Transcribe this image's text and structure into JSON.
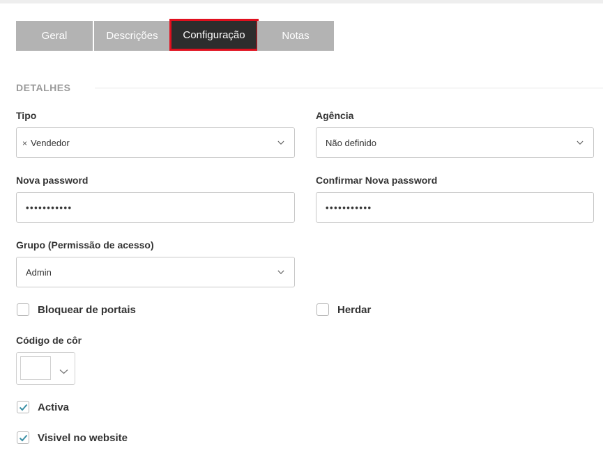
{
  "tabs": [
    {
      "label": "Geral"
    },
    {
      "label": "Descrições"
    },
    {
      "label": "Configuração"
    },
    {
      "label": "Notas"
    }
  ],
  "section": {
    "title": "DETALHES"
  },
  "fields": {
    "tipo": {
      "label": "Tipo",
      "value": "Vendedor",
      "remove": "×"
    },
    "agencia": {
      "label": "Agência",
      "value": "Não definido"
    },
    "nova_password": {
      "label": "Nova password",
      "value": "•••••••••••"
    },
    "confirmar_password": {
      "label": "Confirmar Nova password",
      "value": "•••••••••••"
    },
    "grupo": {
      "label": "Grupo (Permissão de acesso)",
      "value": "Admin"
    },
    "codigo_cor": {
      "label": "Código de côr",
      "value": "#ffffff"
    }
  },
  "checkboxes": {
    "bloquear": {
      "label": "Bloquear de portais",
      "checked": false
    },
    "herdar": {
      "label": "Herdar",
      "checked": false
    },
    "activa": {
      "label": "Activa",
      "checked": true
    },
    "visivel": {
      "label": "Visivel no website",
      "checked": true
    }
  },
  "colors": {
    "tab_inactive": "#b3b3b3",
    "tab_active": "#2d2d2d",
    "tab_active_border": "#e0101e",
    "checkmark": "#3a8fa5"
  }
}
